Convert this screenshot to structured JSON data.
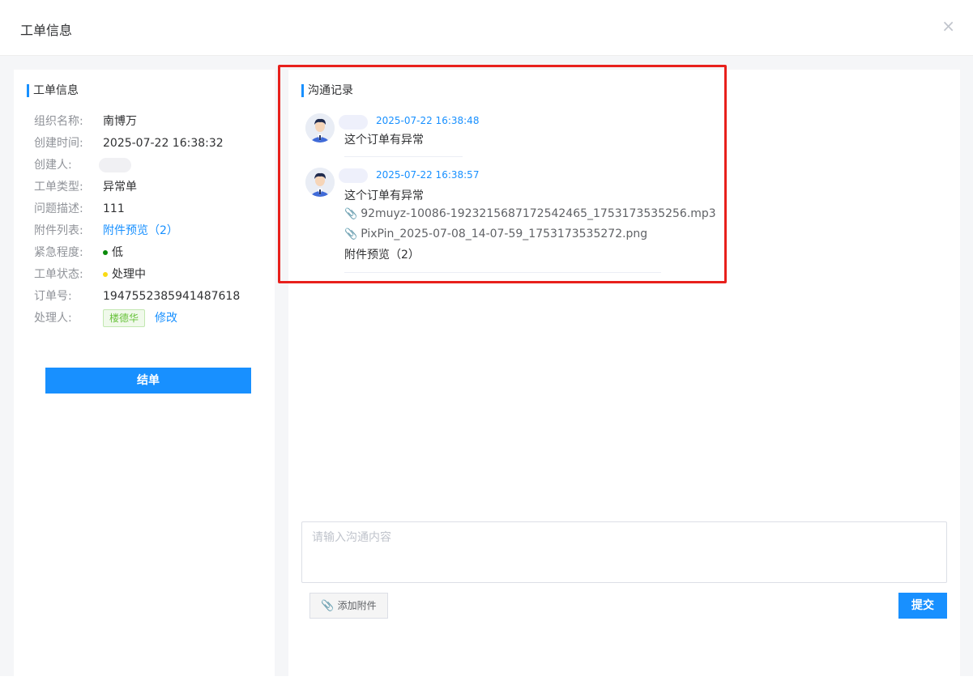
{
  "modal": {
    "title": "工单信息",
    "close_label": "×"
  },
  "left": {
    "section_title": "工单信息",
    "rows": [
      {
        "label": "组织名称:",
        "value": "南博万"
      },
      {
        "label": "创建时间:",
        "value": "2025-07-22 16:38:32"
      },
      {
        "label": "创建人:",
        "value": ""
      },
      {
        "label": "工单类型:",
        "value": "异常单"
      },
      {
        "label": "问题描述:",
        "value": "111"
      },
      {
        "label": "附件列表:",
        "value": "附件预览（2）"
      },
      {
        "label": "紧急程度:",
        "value": "低"
      },
      {
        "label": "工单状态:",
        "value": "处理中"
      },
      {
        "label": "订单号:",
        "value": "1947552385941487618"
      },
      {
        "label": "处理人:",
        "value": "楼德华",
        "action": "修改"
      }
    ],
    "finish_button": "结单",
    "colors": {
      "urgency_dot": "#0a8a0a",
      "status_dot": "#fadb14"
    }
  },
  "right": {
    "section_title": "沟通记录",
    "messages": [
      {
        "time": "2025-07-22 16:38:48",
        "text": "这个订单有异常",
        "files": [],
        "preview": ""
      },
      {
        "time": "2025-07-22 16:38:57",
        "text": "这个订单有异常",
        "files": [
          "92muyz-10086-1923215687172542465_1753173535256.mp3",
          "PixPin_2025-07-08_14-07-59_1753173535272.png"
        ],
        "preview": "附件预览（2）"
      }
    ],
    "input_placeholder": "请输入沟通内容",
    "attach_button": "添加附件",
    "submit_button": "提交"
  },
  "colors": {
    "accent": "#1890ff",
    "highlight": "#e8201c"
  }
}
